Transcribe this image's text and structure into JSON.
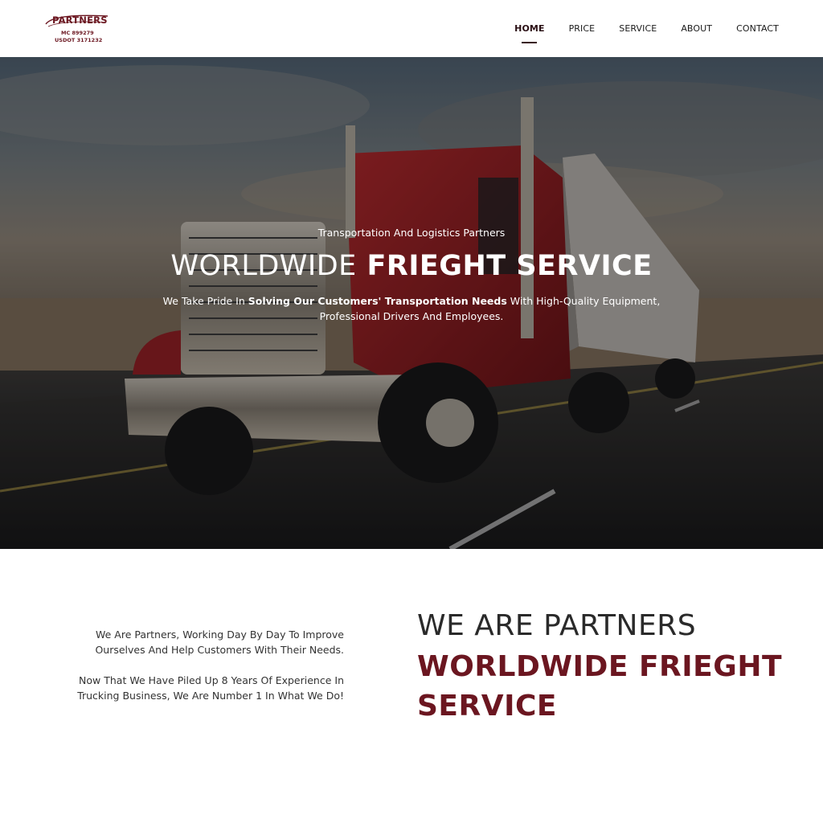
{
  "header": {
    "logo": {
      "name": "PARTNERS",
      "mc": "MC 899279",
      "usdot": "USDOT 3171232"
    },
    "nav": [
      {
        "label": "HOME",
        "active": true
      },
      {
        "label": "PRICE",
        "active": false
      },
      {
        "label": "SERVICE",
        "active": false
      },
      {
        "label": "ABOUT",
        "active": false
      },
      {
        "label": "CONTACT",
        "active": false
      }
    ]
  },
  "hero": {
    "tagline": "Transportation And Logistics Partners",
    "title_light": "WORLDWIDE",
    "title_bold": "FRIEGHT SERVICE",
    "description_pre": "We Take Pride In",
    "description_bold": "Solving Our Customers' Transportation Needs",
    "description_post": "With High-Quality Equipment, Professional Drivers And Employees."
  },
  "about": {
    "paragraph1": "We Are Partners, Working Day By Day To Improve Ourselves And Help Customers With Their Needs.",
    "paragraph2": "Now That We Have Piled Up 8 Years Of Experience In Trucking Business, We Are Number 1 In What We Do!",
    "heading_sub": "WE ARE PARTNERS",
    "heading_main": "WORLDWIDE FRIEGHT SERVICE"
  },
  "colors": {
    "brand": "#6b1620",
    "nav_text": "#1a1a1a",
    "hero_text": "#ffffff"
  }
}
